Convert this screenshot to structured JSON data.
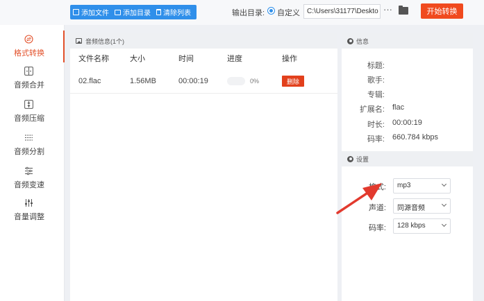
{
  "toolbar": {
    "add_file": "添加文件",
    "add_folder": "添加目录",
    "clear_list": "清除列表",
    "output_label": "输出目录:",
    "custom_label": "自定义",
    "output_path": "C:\\Users\\31177\\Deskto",
    "more": "···",
    "start": "开始转换"
  },
  "sidebar": {
    "items": [
      {
        "label": "格式转换",
        "icon": "format-convert-icon",
        "active": true
      },
      {
        "label": "音频合并",
        "icon": "audio-merge-icon"
      },
      {
        "label": "音频压缩",
        "icon": "audio-compress-icon"
      },
      {
        "label": "音频分割",
        "icon": "audio-split-icon"
      },
      {
        "label": "音频变速",
        "icon": "audio-speed-icon"
      },
      {
        "label": "音量调整",
        "icon": "volume-adjust-icon"
      }
    ]
  },
  "file_panel": {
    "title": "音频信息(1个)",
    "columns": [
      "文件名称",
      "大小",
      "时间",
      "进度",
      "操作"
    ],
    "rows": [
      {
        "name": "02.flac",
        "size": "1.56MB",
        "time": "00:00:19",
        "progress": 0,
        "progress_text": "0%",
        "action": "删除"
      }
    ]
  },
  "info_panel": {
    "title": "信息",
    "fields": [
      {
        "key": "标题:",
        "value": ""
      },
      {
        "key": "歌手:",
        "value": ""
      },
      {
        "key": "专辑:",
        "value": ""
      },
      {
        "key": "扩展名:",
        "value": "flac"
      },
      {
        "key": "时长:",
        "value": "00:00:19"
      },
      {
        "key": "码率:",
        "value": "660.784 kbps"
      }
    ]
  },
  "settings_panel": {
    "title": "设置",
    "format_label": "格式:",
    "format_value": "mp3",
    "channel_label": "声道:",
    "channel_value": "同源音频",
    "bitrate_label": "码率:",
    "bitrate_value": "128 kbps"
  },
  "colors": {
    "accent_blue": "#2f8fea",
    "accent_red": "#f04a1e",
    "active_orange": "#e2502a",
    "annotation_arrow": "#e23a2e"
  }
}
